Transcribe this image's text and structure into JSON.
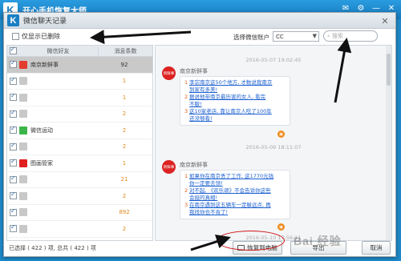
{
  "app": {
    "title": "开心手机恢复大师",
    "logo_letter": "K"
  },
  "dialog": {
    "title": "微信聊天记录",
    "logo_letter": "K"
  },
  "toolbar": {
    "only_deleted_label": "仅显示已删除",
    "account_label": "选择微信账户",
    "account_value": "CC",
    "search_placeholder": "搜索"
  },
  "contact_list": {
    "header": {
      "name": "微信好友",
      "count": "消息条数"
    },
    "rows": [
      {
        "name": "南京新鲜事",
        "count": "92",
        "selected": true,
        "avatar_color": "#e33b2e",
        "blur": false
      },
      {
        "name": "",
        "count": "1",
        "selected": false,
        "avatar_color": "#c8c8c8",
        "blur": true
      },
      {
        "name": "",
        "count": "1",
        "selected": false,
        "avatar_color": "#c8c8c8",
        "blur": true
      },
      {
        "name": "",
        "count": "2",
        "selected": false,
        "avatar_color": "#c8c8c8",
        "blur": true
      },
      {
        "name": "微信运动",
        "count": "2",
        "selected": false,
        "avatar_color": "#3bb54a",
        "blur": false
      },
      {
        "name": "",
        "count": "2",
        "selected": false,
        "avatar_color": "#c8c8c8",
        "blur": true
      },
      {
        "name": "图画管家",
        "count": "1",
        "selected": false,
        "avatar_color": "#e02020",
        "blur": false
      },
      {
        "name": "",
        "count": "21",
        "selected": false,
        "avatar_color": "#c8c8c8",
        "blur": true
      },
      {
        "name": "",
        "count": "2",
        "selected": false,
        "avatar_color": "#c8c8c8",
        "blur": true
      },
      {
        "name": "",
        "count": "892",
        "selected": false,
        "avatar_color": "#c8c8c8",
        "blur": true
      },
      {
        "name": "",
        "count": "2",
        "selected": false,
        "avatar_color": "#c8c8c8",
        "blur": true
      }
    ]
  },
  "chat": {
    "messages": [
      {
        "timestamp": "2016-05-07 19:02:45",
        "sender": "南京新鲜事",
        "avatar_text": "新鲜事",
        "lines": [
          {
            "num": "1",
            "text": "李宗南京这50个地方, 才数说我南京"
          },
          {
            "num": "",
            "text": "到家有多美!"
          },
          {
            "num": "2",
            "text": "据说他带南京最历害的女人, 看完"
          },
          {
            "num": "",
            "text": "不服!"
          },
          {
            "num": "3",
            "text": "这10家老店, 靠让南京人吃了100年"
          },
          {
            "num": "",
            "text": "还没够看!"
          }
        ]
      },
      {
        "timestamp": "2016-05-09 18:11:07",
        "sender": "南京新鲜事",
        "avatar_text": "新鲜事",
        "lines": [
          {
            "num": "1",
            "text": "如果你在南京丢了工作, 这1770元钱"
          },
          {
            "num": "",
            "text": "你一定要去领!"
          },
          {
            "num": "2",
            "text": "对不起, 《欢乐颂》不会告诉你这些"
          },
          {
            "num": "",
            "text": "会挺的真相!"
          },
          {
            "num": "3",
            "text": "在南京遇到这五辆车一定躲远点, 再"
          },
          {
            "num": "",
            "text": "我找你也不肯了!"
          }
        ]
      },
      {
        "timestamp": "2016-05-10 17:56:11"
      }
    ]
  },
  "footer": {
    "selection_status": "已选择 ( 422 ) 项, 总共 ( 422 ) 项",
    "restore_label": "恢复到电脑",
    "export_label": "导出",
    "cancel_label": "取消"
  },
  "watermark": "Bai 经验"
}
